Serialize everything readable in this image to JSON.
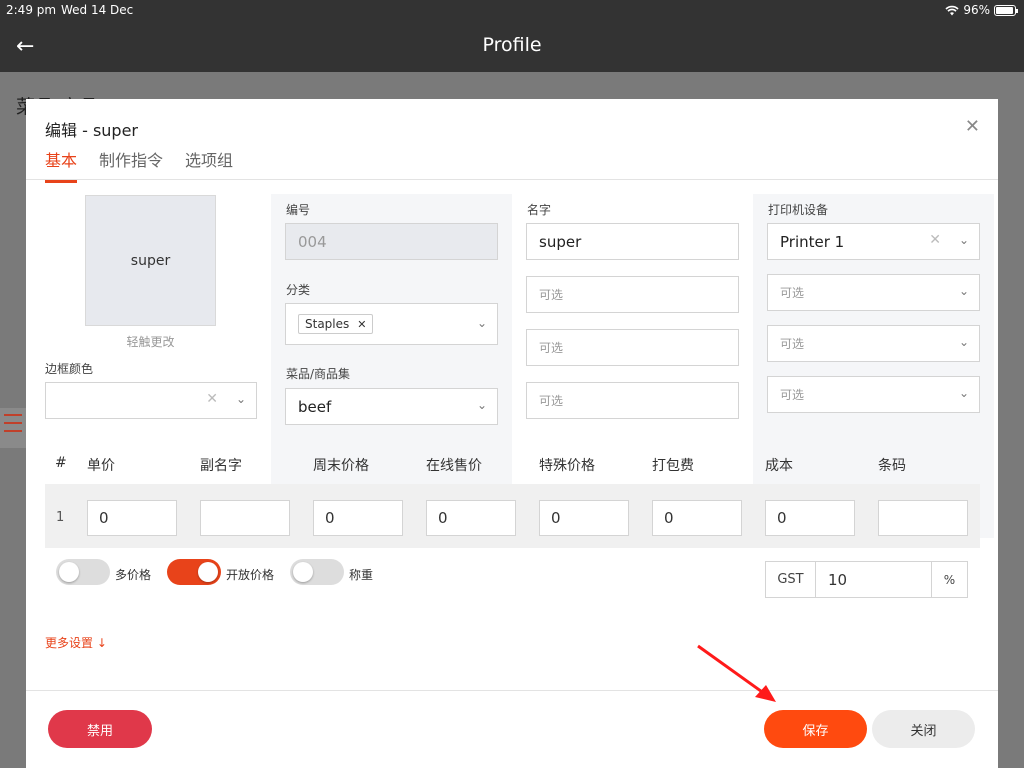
{
  "status_bar": {
    "time": "2:49 pm",
    "date": "Wed 14 Dec",
    "battery": "96%",
    "battery_level": 0.96
  },
  "app_bar": {
    "title": "Profile",
    "back_icon": "arrow-left-icon"
  },
  "background": {
    "heading": "菜品/商品"
  },
  "modal": {
    "title": "编辑 - super",
    "tabs": [
      {
        "label": "基本",
        "active": true
      },
      {
        "label": "制作指令",
        "active": false
      },
      {
        "label": "选项组",
        "active": false
      }
    ],
    "image": {
      "text": "super",
      "hint": "轻触更改"
    },
    "border_color": {
      "label": "边框颜色",
      "value": ""
    },
    "code": {
      "label": "编号",
      "value": "004"
    },
    "category": {
      "label": "分类",
      "tag": "Staples"
    },
    "item_set": {
      "label": "菜品/商品集",
      "value": "beef"
    },
    "name": {
      "label": "名字",
      "value": "super",
      "alt_placeholders": [
        "可选",
        "可选",
        "可选"
      ]
    },
    "printer": {
      "label": "打印机设备",
      "value": "Printer 1",
      "alt_placeholders": [
        "可选",
        "可选",
        "可选"
      ]
    },
    "price_table": {
      "headers": [
        "#",
        "单价",
        "副名字",
        "周末价格",
        "在线售价",
        "特殊价格",
        "打包费",
        "成本",
        "条码"
      ],
      "rows": [
        {
          "num": "1",
          "cells": [
            "0",
            "",
            "0",
            "0",
            "0",
            "0",
            "0",
            ""
          ]
        }
      ]
    },
    "toggles": [
      {
        "label": "多价格",
        "on": false
      },
      {
        "label": "开放价格",
        "on": true
      },
      {
        "label": "称重",
        "on": false
      }
    ],
    "tax": {
      "prefix": "GST",
      "value": "10",
      "suffix": "%"
    },
    "more_settings": "更多设置 ↓",
    "buttons": {
      "disable": "禁用",
      "save": "保存",
      "close": "关闭"
    },
    "colors": {
      "accent": "#e8431a",
      "save": "#ff4a0f",
      "disable": "#e0384a",
      "arrow": "#ff1a1a"
    }
  }
}
